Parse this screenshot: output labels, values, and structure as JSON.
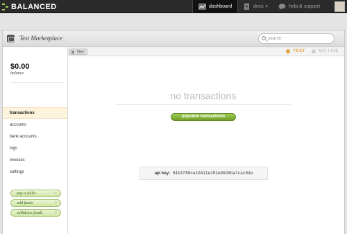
{
  "topbar": {
    "brand": "BALANCED",
    "nav": [
      {
        "label": "dashboard",
        "icon": "dashboard-icon",
        "active": true
      },
      {
        "label": "docs",
        "icon": "docs-icon",
        "caret": "▾"
      },
      {
        "label": "help & support",
        "icon": "speech-bubble-icon"
      }
    ]
  },
  "marketplace": {
    "name": "Test Marketplace",
    "search_placeholder": "search"
  },
  "filterbar": {
    "filter_label": "filter",
    "modes": [
      {
        "label": "TEST",
        "active": true,
        "color": "#e0a23a"
      },
      {
        "label": "GO LIVE",
        "active": false,
        "color": "#bbbbbb"
      }
    ]
  },
  "sidebar": {
    "balance": "$0.00",
    "balance_label": "balance",
    "items": [
      {
        "label": "transactions",
        "active": true
      },
      {
        "label": "accounts"
      },
      {
        "label": "bank accounts"
      },
      {
        "label": "logs"
      },
      {
        "label": "invoices"
      },
      {
        "label": "settings"
      }
    ],
    "actions": [
      {
        "label": "pay a seller",
        "chevron": ">"
      },
      {
        "label": "add funds",
        "chevron": ">"
      },
      {
        "label": "withdraw funds",
        "chevron": ">"
      }
    ]
  },
  "content": {
    "empty_title": "no transactions",
    "populate_label": "populate transactions",
    "api_key_label": "api key:",
    "api_key_value": "61b1f80ce10411e292e8026ba7cac9da"
  },
  "colors": {
    "accent_green": "#7aa832",
    "test_orange": "#e0a23a",
    "topbar_bg": "#2b2b2b"
  }
}
